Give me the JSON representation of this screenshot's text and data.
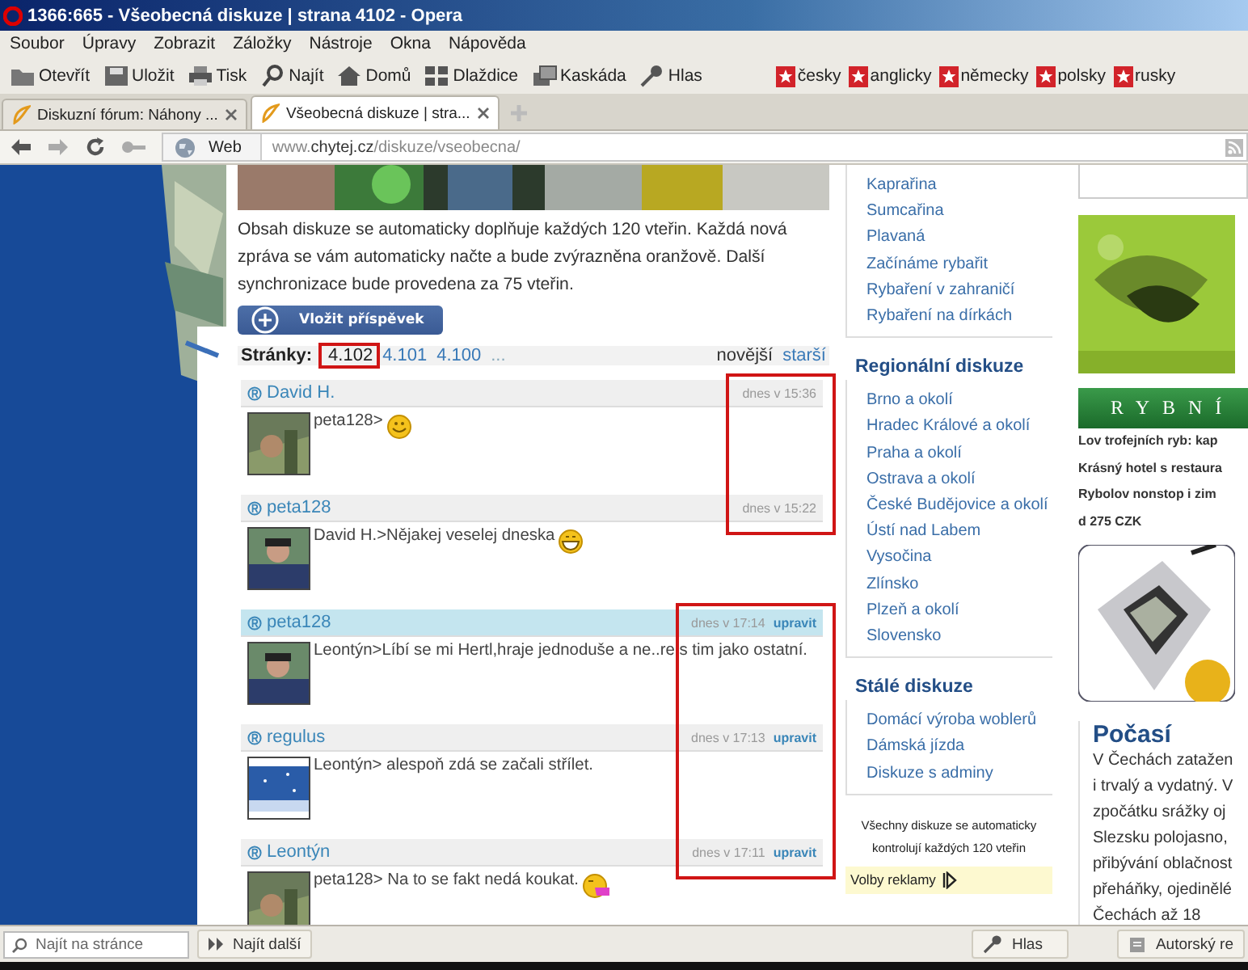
{
  "window": {
    "title": "1366:665 - Všeobecná diskuze | strana 4102 - Opera"
  },
  "menu": [
    "Soubor",
    "Úpravy",
    "Zobrazit",
    "Záložky",
    "Nástroje",
    "Okna",
    "Nápověda"
  ],
  "toolbar": [
    {
      "kind": "folder",
      "label": "Otevřít"
    },
    {
      "kind": "save",
      "label": "Uložit"
    },
    {
      "kind": "print",
      "label": "Tisk"
    },
    {
      "kind": "search",
      "label": "Najít"
    },
    {
      "kind": "home",
      "label": "Domů"
    },
    {
      "kind": "tiles",
      "label": "Dlaždice"
    },
    {
      "kind": "cascade",
      "label": "Kaskáda"
    },
    {
      "kind": "mic",
      "label": "Hlas"
    }
  ],
  "bookmarks": [
    "česky",
    "anglicky",
    "německy",
    "polsky",
    "rusky"
  ],
  "tabs": [
    {
      "label": "Diskuzní fórum: Náhony ...",
      "selected": false
    },
    {
      "label": "Všeobecná diskuze | stra...",
      "selected": true
    }
  ],
  "address": {
    "scheme_label": "Web",
    "url_prefix": "www.",
    "url_domain": "chytej.cz",
    "url_path": "/diskuze/vseobecna/"
  },
  "intro": "Obsah diskuze se automaticky doplňuje každých 120 vteřin. Každá nová zpráva se vám automaticky načte a bude zvýrazněna oranžově. Další synchronizace bude provedena za 75 vteřin.",
  "post_button": "Vložit příspěvek",
  "pages": {
    "label": "Stránky:",
    "items": [
      {
        "label": "4.102",
        "selected": true
      },
      {
        "label": "4.101",
        "selected": false
      },
      {
        "label": "4.100",
        "selected": false
      }
    ],
    "more": "...",
    "newer": {
      "label": "novější",
      "disabled": true
    },
    "older": {
      "label": "starší",
      "disabled": false
    }
  },
  "posts": [
    {
      "author": "David H.",
      "time": "dnes v 15:36",
      "text": "peta128>",
      "emoticon": {
        "kind": "smile"
      },
      "highlighted": false,
      "framed": true,
      "frame_start": true
    },
    {
      "author": "peta128",
      "time": "dnes v 15:22",
      "text": "David H.>Nějakej veselej dneska",
      "emoticon": {
        "kind": "grin"
      },
      "highlighted": false,
      "framed": true,
      "frame_start": false
    },
    {
      "author": "peta128",
      "time": "dnes v 17:14",
      "edit": "upravit",
      "text": "Leontýn>Líbí se mi Hertl,hraje jednoduše a ne..re s tim jako ostatní.",
      "highlighted": true,
      "framed": true,
      "frame_start": true
    },
    {
      "author": "regulus",
      "time": "dnes v 17:13",
      "edit": "upravit",
      "text": "Leontýn> alespoň zdá se začali střílet.",
      "highlighted": false,
      "framed": true,
      "frame_start": false
    },
    {
      "author": "Leontýn",
      "time": "dnes v 17:11",
      "edit": "upravit",
      "text": "peta128> Na to se fakt nedá koukat.",
      "emoticon": {
        "kind": "tongue"
      },
      "highlighted": false,
      "framed": true,
      "frame_start": false
    }
  ],
  "sidebar": {
    "sections": [
      {
        "items": [
          "Kaprařina",
          "Sumcařina",
          "Plavaná",
          "Začínáme rybařit",
          "Rybaření v zahraničí",
          "Rybaření na dírkách"
        ]
      },
      {
        "title": "Regionální diskuze",
        "items": [
          "Brno a okolí",
          "Hradec Králové a okolí",
          "Praha a okolí",
          "Ostrava a okolí",
          "České Budějovice a okolí",
          "Ústí nad Labem",
          "Vysočina",
          "Zlínsko",
          "Plzeň a okolí",
          "Slovensko"
        ]
      },
      {
        "title": "Stálé diskuze",
        "items": [
          "Domácí výroba woblerů",
          "Dámská jízda",
          "Diskuze s adminy"
        ]
      }
    ],
    "note": "Všechny diskuze se automaticky kontrolují každých 120 vteřin",
    "ad_options": "Volby reklamy"
  },
  "ads": {
    "banner": "RYBNÍ",
    "lines": [
      "Lov trofejních ryb: kap",
      "Krásný hotel s restaura",
      "Rybolov nonstop i zim",
      "d 275 CZK"
    ]
  },
  "weather": {
    "title": "Počasí",
    "lines": [
      "V Čechách zatažen",
      "i trvalý a vydatný. V",
      "zpočátku srážky oj",
      "Slezsku polojasno,",
      "přibývání oblačnost",
      "přeháňky, ojedinělé",
      "Čechách až 18"
    ]
  },
  "find_bar": {
    "placeholder": "Najít na stránce",
    "next": "Najít další",
    "voice": "Hlas",
    "author": "Autorský re"
  }
}
